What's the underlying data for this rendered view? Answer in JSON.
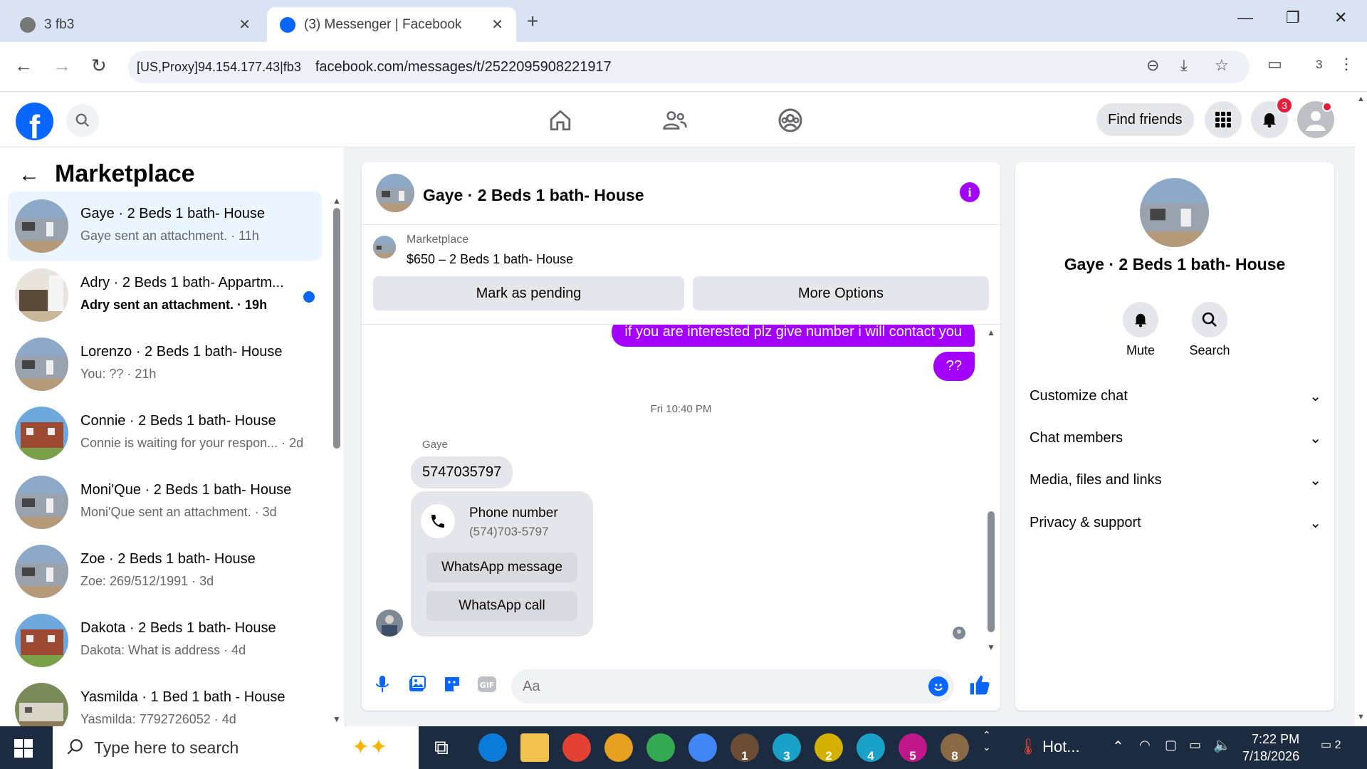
{
  "browser": {
    "tabs": [
      {
        "label": "3 fb3"
      },
      {
        "label": "(3) Messenger | Facebook"
      }
    ],
    "proxy_label": "[US,Proxy]94.154.177.43|fb3",
    "url": "facebook.com/messages/t/2522095908221917",
    "profile_count": "3"
  },
  "fb_header": {
    "logo": "f",
    "find_friends": "Find friends",
    "notification_count": "3"
  },
  "sidebar": {
    "title": "Marketplace",
    "conversations": [
      {
        "name": "Gaye · 2 Beds 1 bath- House",
        "preview": "Gaye sent an attachment. · 11h",
        "active": true,
        "unread": false,
        "thumb": "house-gray"
      },
      {
        "name": "Adry · 2 Beds 1 bath- Appartm...",
        "preview": "Adry sent an attachment. · 19h",
        "active": false,
        "unread": true,
        "thumb": "interior"
      },
      {
        "name": "Lorenzo · 2 Beds 1 bath- House",
        "preview": "You: ?? · 21h",
        "active": false,
        "unread": false,
        "thumb": "house-gray"
      },
      {
        "name": "Connie · 2 Beds 1 bath- House",
        "preview": "Connie is waiting for your respon... · 2d",
        "active": false,
        "unread": false,
        "thumb": "house-brick"
      },
      {
        "name": "Moni'Que · 2 Beds 1 bath- House",
        "preview": "Moni'Que sent an attachment. · 3d",
        "active": false,
        "unread": false,
        "thumb": "house-gray"
      },
      {
        "name": "Zoe · 2 Beds 1 bath- House",
        "preview": "Zoe: 269/512/1991 · 3d",
        "active": false,
        "unread": false,
        "thumb": "house-gray"
      },
      {
        "name": "Dakota · 2 Beds 1 bath- House",
        "preview": "Dakota: What is address · 4d",
        "active": false,
        "unread": false,
        "thumb": "house-brick"
      },
      {
        "name": "Yasmilda · 1 Bed 1 bath - House",
        "preview": "Yasmilda: 7792726052 · 4d",
        "active": false,
        "unread": false,
        "thumb": "house-mobile"
      }
    ]
  },
  "chat": {
    "title": "Gaye · 2 Beds 1 bath- House",
    "marketplace_label": "Marketplace",
    "listing": "$650 – 2 Beds 1 bath- House",
    "mark_pending": "Mark as pending",
    "more_options": "More Options",
    "messages": {
      "out1": "if you are interested plz give number i will contact you",
      "out2": "??",
      "timestamp": "Fri 10:40 PM",
      "sender": "Gaye",
      "in1": "5747035797",
      "card_title": "Phone number",
      "card_number": "(574)703-5797",
      "whatsapp_message": "WhatsApp message",
      "whatsapp_call": "WhatsApp call"
    },
    "composer_placeholder": "Aa"
  },
  "right_panel": {
    "name": "Gaye · 2 Beds 1 bath- House",
    "mute": "Mute",
    "search": "Search",
    "sections": [
      "Customize chat",
      "Chat members",
      "Media, files and links",
      "Privacy & support"
    ]
  },
  "taskbar": {
    "search_placeholder": "Type here to search",
    "weather": "Hot...",
    "time": "7:22 PM",
    "date": "7/18/2026",
    "notifications": "2",
    "app_numbers": [
      "1",
      "3",
      "2",
      "4",
      "5",
      "8"
    ]
  },
  "colors": {
    "fb_blue": "#0866ff",
    "messenger_purple": "#a400ff",
    "taskbar": "#1c2b3f"
  }
}
